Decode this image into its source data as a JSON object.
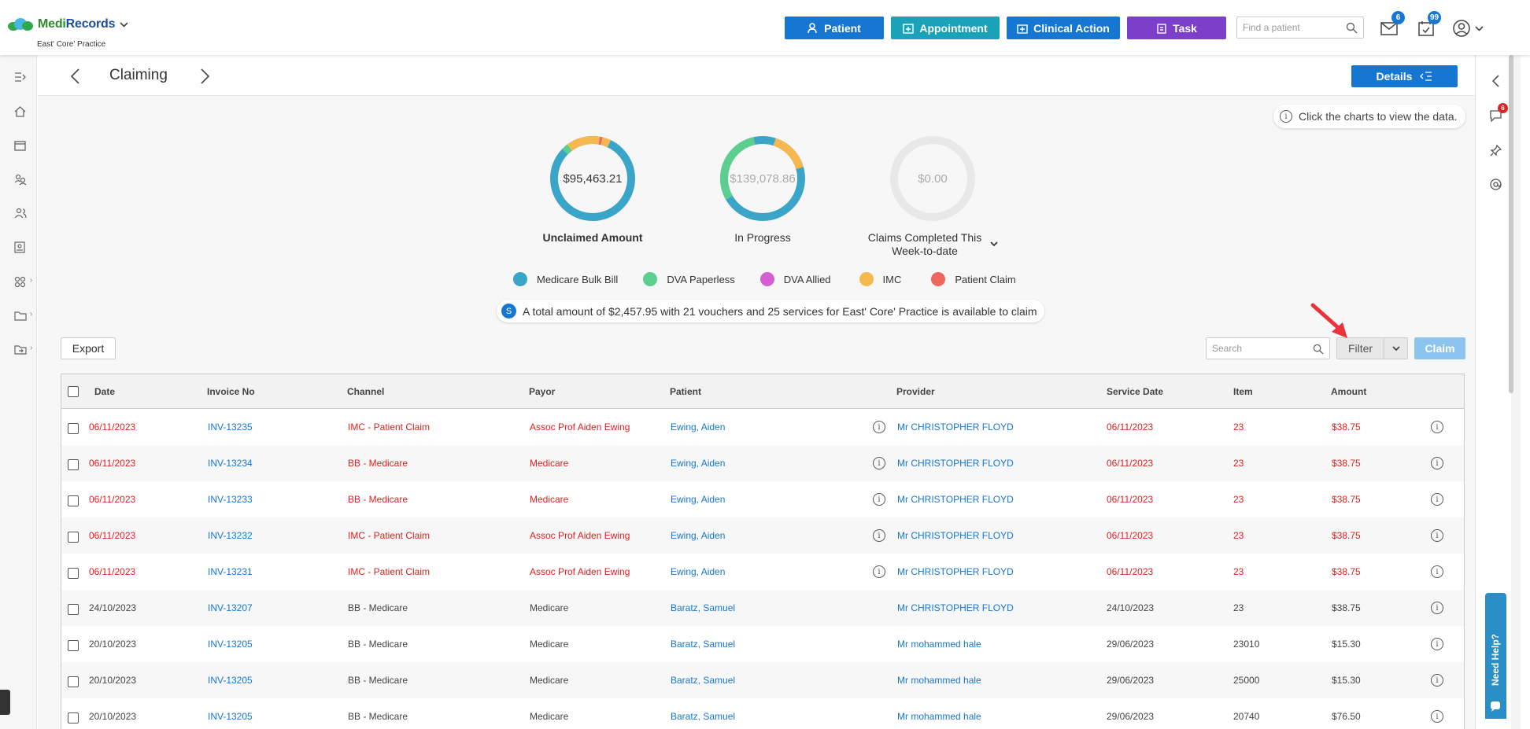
{
  "brand": {
    "name_part1": "Medi",
    "name_part2": "Records",
    "practice": "East' Core' Practice"
  },
  "topbar": {
    "buttons": [
      {
        "label": "Patient",
        "color": "#1677d2"
      },
      {
        "label": "Appointment",
        "color": "#1aa3b8"
      },
      {
        "label": "Clinical Action",
        "color": "#1677d2"
      },
      {
        "label": "Task",
        "color": "#7c3fc9"
      }
    ],
    "find_placeholder": "Find a patient",
    "mail_count": "6",
    "tasks_count": "99"
  },
  "page": {
    "title": "Claiming",
    "details_label": "Details"
  },
  "hint": "Click the charts to view the data.",
  "summary": [
    {
      "value": "$95,463.21",
      "label": "Unclaimed Amount"
    },
    {
      "value": "$139,078.86",
      "label": "In Progress"
    },
    {
      "value": "$0.00",
      "label": "Claims Completed This Week-to-date"
    }
  ],
  "legend": [
    {
      "label": "Medicare Bulk Bill",
      "color": "#3ba4c9"
    },
    {
      "label": "DVA Paperless",
      "color": "#5ccf8f"
    },
    {
      "label": "DVA Allied",
      "color": "#d45fd0"
    },
    {
      "label": "IMC",
      "color": "#f8b850"
    },
    {
      "label": "Patient Claim",
      "color": "#f0675f"
    }
  ],
  "chart_data": [
    {
      "type": "pie",
      "title": "Unclaimed Amount",
      "total": "$95,463.21",
      "slices": [
        {
          "name": "Medicare Bulk Bill",
          "value": 0.8
        },
        {
          "name": "DVA Paperless",
          "value": 0.02
        },
        {
          "name": "IMC",
          "value": 0.17
        },
        {
          "name": "Patient Claim",
          "value": 0.01
        }
      ]
    },
    {
      "type": "pie",
      "title": "In Progress",
      "total": "$139,078.86",
      "slices": [
        {
          "name": "Medicare Bulk Bill",
          "value": 0.55
        },
        {
          "name": "DVA Paperless",
          "value": 0.3
        },
        {
          "name": "IMC",
          "value": 0.15
        }
      ]
    },
    {
      "type": "pie",
      "title": "Claims Completed This Week-to-date",
      "total": "$0.00",
      "slices": []
    }
  ],
  "notice": {
    "icon": "S",
    "text": "A total amount of $2,457.95 with 21 vouchers and 25 services for East' Core' Practice is available to claim"
  },
  "toolbar": {
    "export": "Export",
    "search_placeholder": "Search",
    "filter": "Filter",
    "claim": "Claim"
  },
  "table": {
    "columns": [
      "Date",
      "Invoice No",
      "Channel",
      "Payor",
      "Patient",
      "Provider",
      "Service Date",
      "Item",
      "Amount"
    ],
    "rows": [
      {
        "date": "06/11/2023",
        "invoice": "INV-13235",
        "channel": "IMC - Patient Claim",
        "payor": "Assoc Prof Aiden Ewing",
        "patient": "Ewing, Aiden",
        "provider": "Mr CHRISTOPHER FLOYD",
        "service_date": "06/11/2023",
        "item": "23",
        "amount": "$38.75",
        "highlight": true,
        "patient_info": true
      },
      {
        "date": "06/11/2023",
        "invoice": "INV-13234",
        "channel": "BB - Medicare",
        "payor": "Medicare",
        "patient": "Ewing, Aiden",
        "provider": "Mr CHRISTOPHER FLOYD",
        "service_date": "06/11/2023",
        "item": "23",
        "amount": "$38.75",
        "highlight": true,
        "patient_info": true
      },
      {
        "date": "06/11/2023",
        "invoice": "INV-13233",
        "channel": "BB - Medicare",
        "payor": "Medicare",
        "patient": "Ewing, Aiden",
        "provider": "Mr CHRISTOPHER FLOYD",
        "service_date": "06/11/2023",
        "item": "23",
        "amount": "$38.75",
        "highlight": true,
        "patient_info": true
      },
      {
        "date": "06/11/2023",
        "invoice": "INV-13232",
        "channel": "IMC - Patient Claim",
        "payor": "Assoc Prof Aiden Ewing",
        "patient": "Ewing, Aiden",
        "provider": "Mr CHRISTOPHER FLOYD",
        "service_date": "06/11/2023",
        "item": "23",
        "amount": "$38.75",
        "highlight": true,
        "patient_info": true
      },
      {
        "date": "06/11/2023",
        "invoice": "INV-13231",
        "channel": "IMC - Patient Claim",
        "payor": "Assoc Prof Aiden Ewing",
        "patient": "Ewing, Aiden",
        "provider": "Mr CHRISTOPHER FLOYD",
        "service_date": "06/11/2023",
        "item": "23",
        "amount": "$38.75",
        "highlight": true,
        "patient_info": true
      },
      {
        "date": "24/10/2023",
        "invoice": "INV-13207",
        "channel": "BB - Medicare",
        "payor": "Medicare",
        "patient": "Baratz, Samuel",
        "provider": "Mr CHRISTOPHER FLOYD",
        "service_date": "24/10/2023",
        "item": "23",
        "amount": "$38.75",
        "highlight": false,
        "patient_info": false
      },
      {
        "date": "20/10/2023",
        "invoice": "INV-13205",
        "channel": "BB - Medicare",
        "payor": "Medicare",
        "patient": "Baratz, Samuel",
        "provider": "Mr mohammed hale",
        "service_date": "29/06/2023",
        "item": "23010",
        "amount": "$15.30",
        "highlight": false,
        "patient_info": false
      },
      {
        "date": "20/10/2023",
        "invoice": "INV-13205",
        "channel": "BB - Medicare",
        "payor": "Medicare",
        "patient": "Baratz, Samuel",
        "provider": "Mr mohammed hale",
        "service_date": "29/06/2023",
        "item": "25000",
        "amount": "$15.30",
        "highlight": false,
        "patient_info": false
      },
      {
        "date": "20/10/2023",
        "invoice": "INV-13205",
        "channel": "BB - Medicare",
        "payor": "Medicare",
        "patient": "Baratz, Samuel",
        "provider": "Mr mohammed hale",
        "service_date": "29/06/2023",
        "item": "20740",
        "amount": "$76.50",
        "highlight": false,
        "patient_info": false
      }
    ]
  },
  "right_panel": {
    "chat_count": "6",
    "help_label": "Need Help?"
  }
}
